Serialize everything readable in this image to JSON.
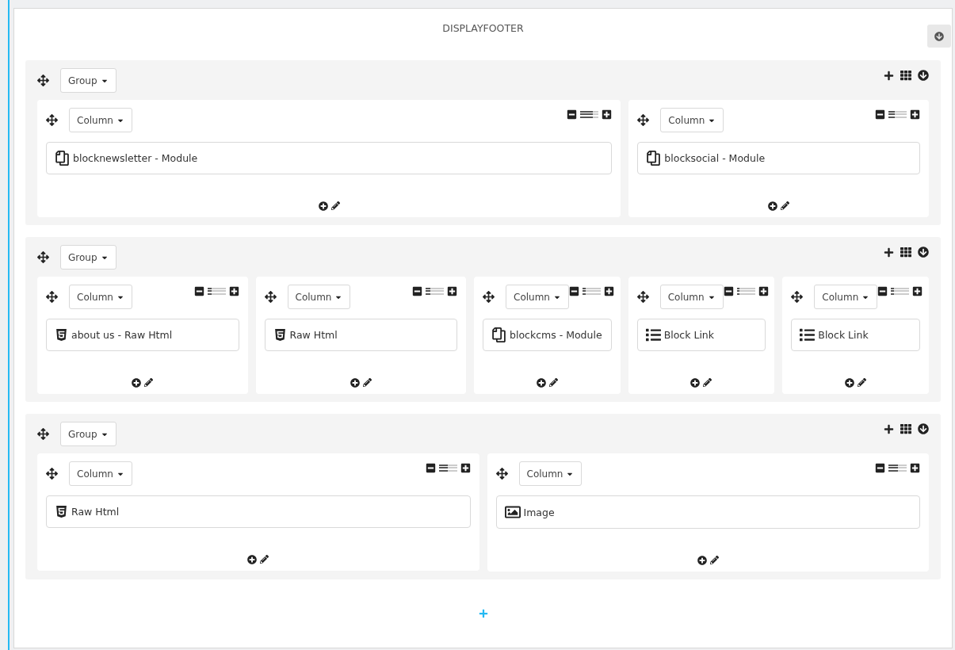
{
  "title": "DISPLAYFOOTER",
  "groups": [
    {
      "label": "Group",
      "columns": [
        {
          "label": "Column",
          "level": 0.667,
          "items": [
            {
              "kind": "module",
              "text": "blocknewsletter - Module"
            }
          ]
        },
        {
          "label": "Column",
          "level": 0.333,
          "items": [
            {
              "kind": "module",
              "text": "blocksocial - Module"
            }
          ]
        }
      ]
    },
    {
      "label": "Group",
      "columns": [
        {
          "label": "Column",
          "level": 0.25,
          "items": [
            {
              "kind": "html",
              "text": "about us - Raw Html"
            }
          ]
        },
        {
          "label": "Column",
          "level": 0.25,
          "items": [
            {
              "kind": "html",
              "text": "Raw Html"
            }
          ]
        },
        {
          "label": "Column",
          "level": 0.167,
          "items": [
            {
              "kind": "module",
              "text": "blockcms - Module"
            }
          ]
        },
        {
          "label": "Column",
          "level": 0.167,
          "items": [
            {
              "kind": "link",
              "text": "Block Link"
            }
          ]
        },
        {
          "label": "Column",
          "level": 0.167,
          "items": [
            {
              "kind": "link",
              "text": "Block Link"
            }
          ]
        }
      ]
    },
    {
      "label": "Group",
      "columns": [
        {
          "label": "Column",
          "level": 0.5,
          "items": [
            {
              "kind": "html",
              "text": "Raw Html"
            }
          ]
        },
        {
          "label": "Column",
          "level": 0.5,
          "items": [
            {
              "kind": "image",
              "text": "Image"
            }
          ]
        }
      ]
    }
  ]
}
